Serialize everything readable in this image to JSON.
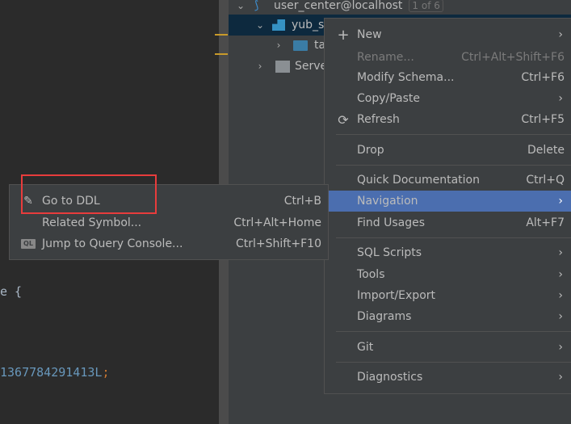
{
  "editor": {
    "line1": "e {",
    "line2": "1367784291413L",
    "line2_semicolon": ";",
    "colors": {
      "number": "#6897bb",
      "semicolon": "#cc7832"
    }
  },
  "tree": {
    "connection": "user_center@localhost",
    "badge": "1 of 6",
    "schema": "yub_s",
    "tables": "ta",
    "servers": "Serve"
  },
  "context_menu": {
    "items": [
      {
        "label": "New",
        "icon": "plus-icon",
        "submenu": true
      },
      {
        "label": "Rename...",
        "shortcut": "Ctrl+Alt+Shift+F6",
        "disabled": true
      },
      {
        "label": "Modify Schema...",
        "shortcut": "Ctrl+F6"
      },
      {
        "label": "Copy/Paste",
        "submenu": true
      },
      {
        "label": "Refresh",
        "shortcut": "Ctrl+F5",
        "icon": "refresh-icon"
      },
      {
        "label": "Drop",
        "shortcut": "Delete"
      },
      {
        "label": "Quick Documentation",
        "shortcut": "Ctrl+Q"
      },
      {
        "label": "Navigation",
        "submenu": true,
        "highlighted": true
      },
      {
        "label": "Find Usages",
        "shortcut": "Alt+F7"
      },
      {
        "label": "SQL Scripts",
        "submenu": true
      },
      {
        "label": "Tools",
        "submenu": true
      },
      {
        "label": "Import/Export",
        "submenu": true
      },
      {
        "label": "Diagrams",
        "submenu": true
      },
      {
        "label": "Git",
        "submenu": true
      },
      {
        "label": "Diagnostics",
        "submenu": true
      }
    ]
  },
  "navigation_submenu": {
    "items": [
      {
        "label": "Go to DDL",
        "shortcut": "Ctrl+B",
        "icon": "pencil-icon"
      },
      {
        "label": "Related Symbol...",
        "shortcut": "Ctrl+Alt+Home"
      },
      {
        "label": "Jump to Query Console...",
        "shortcut": "Ctrl+Shift+F10",
        "icon": "ql-console-icon"
      }
    ]
  },
  "colors": {
    "highlight": "#4b6eaf",
    "annotation_box": "#e83c3c",
    "selected_row": "#0d293e"
  }
}
